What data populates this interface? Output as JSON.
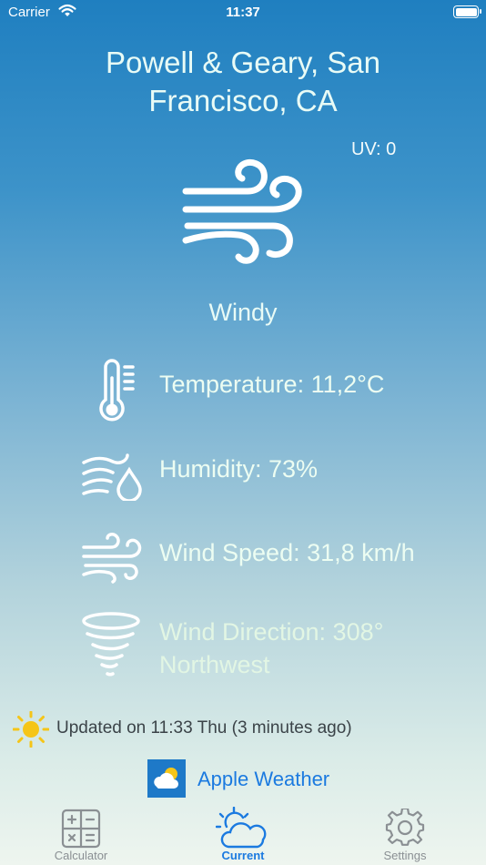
{
  "status_bar": {
    "carrier": "Carrier",
    "time": "11:37"
  },
  "location": {
    "line1": "Powell & Geary, San",
    "line2": "Francisco, CA"
  },
  "uv": "UV: 0",
  "condition": "Windy",
  "metrics": {
    "temperature": "Temperature: 11,2°C",
    "humidity": "Humidity: 73%",
    "wind_speed": "Wind Speed: 31,8 km/h",
    "wind_direction_1": "Wind Direction: 308°",
    "wind_direction_2": "Northwest"
  },
  "updated": "Updated on 11:33 Thu (3 minutes ago)",
  "attribution": "Apple Weather",
  "tabs": [
    {
      "label": "Calculator",
      "icon": "calculator-icon",
      "active": false
    },
    {
      "label": "Current",
      "icon": "sun-cloud-icon",
      "active": true
    },
    {
      "label": "Settings",
      "icon": "gear-icon",
      "active": false
    }
  ],
  "colors": {
    "accent": "#1b7ae0",
    "sun": "#f5c518",
    "tab_inactive": "#8a8f93"
  }
}
